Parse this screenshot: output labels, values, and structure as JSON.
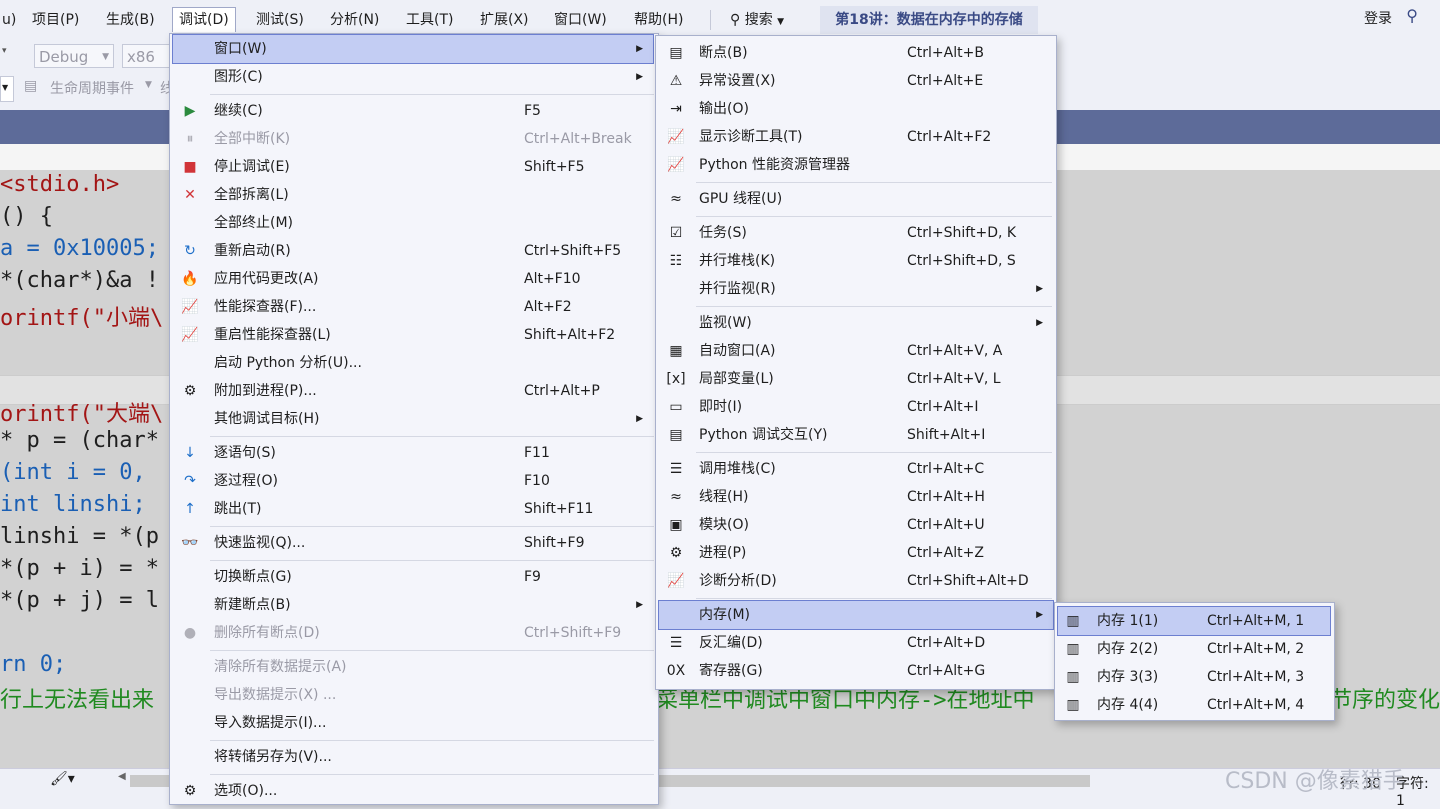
{
  "menubar": {
    "partial_first": "u)",
    "items": [
      "项目(P)",
      "生成(B)",
      "调试(D)",
      "测试(S)",
      "分析(N)",
      "工具(T)",
      "扩展(X)",
      "窗口(W)",
      "帮助(H)"
    ],
    "search_label": "搜索",
    "project_title": "第18讲：数据在内存中的存储",
    "login": "登录"
  },
  "toolbar": {
    "config": "Debug",
    "platform": "x86",
    "lifecycle": "生命周期事件",
    "partial": "线"
  },
  "code": {
    "lines": [
      {
        "text": "<stdio.h>",
        "cls": "str"
      },
      {
        "text": "() {",
        "cls": ""
      },
      {
        "text": "a = 0x10005;",
        "cls": "kw"
      },
      {
        "text": "*(char*)&a !",
        "cls": ""
      },
      {
        "text": "orintf(\"小端\\",
        "cls": "str"
      },
      {
        "text": "",
        "cls": ""
      },
      {
        "text": "",
        "cls": ""
      },
      {
        "text": "orintf(\"大端\\",
        "cls": "str"
      },
      {
        "text": "* p = (char*",
        "cls": ""
      },
      {
        "text": "(int i = 0,",
        "cls": "kw"
      },
      {
        "text": "int linshi;",
        "cls": "kw"
      },
      {
        "text": "linshi = *(p",
        "cls": ""
      },
      {
        "text": "*(p + i) = *",
        "cls": ""
      },
      {
        "text": "*(p + j) = l",
        "cls": ""
      },
      {
        "text": "",
        "cls": ""
      },
      {
        "text": "rn 0;",
        "cls": "kw"
      }
    ],
    "comment_left": "行上无法看出来",
    "comment_mid": "菜单栏中调试中窗口中内存->在地址中",
    "comment_right": "节序的变化"
  },
  "status": {
    "pos": "行: 30",
    "encoding": "字符: 1",
    "watermark": "CSDN @像素猎手"
  },
  "debug_menu": {
    "items": [
      {
        "label": "窗口(W)",
        "shortcut": "",
        "icon": "",
        "submenu": true,
        "selected": true
      },
      {
        "label": "图形(C)",
        "shortcut": "",
        "icon": "",
        "submenu": true
      },
      {
        "sep": true
      },
      {
        "label": "继续(C)",
        "shortcut": "F5",
        "icon": "▶",
        "icon_color": "#2b8a3e"
      },
      {
        "label": "全部中断(K)",
        "shortcut": "Ctrl+Alt+Break",
        "icon": "⏸",
        "disabled": true
      },
      {
        "label": "停止调试(E)",
        "shortcut": "Shift+F5",
        "icon": "■",
        "icon_color": "#d13438"
      },
      {
        "label": "全部拆离(L)",
        "shortcut": "",
        "icon": "✕",
        "icon_color": "#d13438"
      },
      {
        "label": "全部终止(M)",
        "shortcut": "",
        "icon": ""
      },
      {
        "label": "重新启动(R)",
        "shortcut": "Ctrl+Shift+F5",
        "icon": "↻",
        "icon_color": "#1e6fc9"
      },
      {
        "label": "应用代码更改(A)",
        "shortcut": "Alt+F10",
        "icon": "🔥",
        "icon_color": "#d13438"
      },
      {
        "label": "性能探查器(F)...",
        "shortcut": "Alt+F2",
        "icon": "📈"
      },
      {
        "label": "重启性能探查器(L)",
        "shortcut": "Shift+Alt+F2",
        "icon": "📈"
      },
      {
        "label": "启动 Python 分析(U)...",
        "shortcut": "",
        "icon": ""
      },
      {
        "label": "附加到进程(P)...",
        "shortcut": "Ctrl+Alt+P",
        "icon": "⚙"
      },
      {
        "label": "其他调试目标(H)",
        "shortcut": "",
        "icon": "",
        "submenu": true
      },
      {
        "sep": true
      },
      {
        "label": "逐语句(S)",
        "shortcut": "F11",
        "icon": "↓",
        "icon_color": "#1e6fc9"
      },
      {
        "label": "逐过程(O)",
        "shortcut": "F10",
        "icon": "↷",
        "icon_color": "#1e6fc9"
      },
      {
        "label": "跳出(T)",
        "shortcut": "Shift+F11",
        "icon": "↑",
        "icon_color": "#1e6fc9"
      },
      {
        "sep": true
      },
      {
        "label": "快速监视(Q)...",
        "shortcut": "Shift+F9",
        "icon": "👓"
      },
      {
        "sep": true
      },
      {
        "label": "切换断点(G)",
        "shortcut": "F9",
        "icon": ""
      },
      {
        "label": "新建断点(B)",
        "shortcut": "",
        "icon": "",
        "submenu": true
      },
      {
        "label": "删除所有断点(D)",
        "shortcut": "Ctrl+Shift+F9",
        "icon": "●",
        "disabled": true
      },
      {
        "sep": true
      },
      {
        "label": "清除所有数据提示(A)",
        "shortcut": "",
        "icon": "",
        "disabled": true
      },
      {
        "label": "导出数据提示(X) ...",
        "shortcut": "",
        "icon": "",
        "disabled": true
      },
      {
        "label": "导入数据提示(I)...",
        "shortcut": "",
        "icon": ""
      },
      {
        "sep": true
      },
      {
        "label": "将转储另存为(V)...",
        "shortcut": "",
        "icon": ""
      },
      {
        "sep": true
      },
      {
        "label": "选项(O)...",
        "shortcut": "",
        "icon": "⚙"
      }
    ]
  },
  "window_menu": {
    "items": [
      {
        "label": "断点(B)",
        "shortcut": "Ctrl+Alt+B",
        "icon": "▤"
      },
      {
        "label": "异常设置(X)",
        "shortcut": "Ctrl+Alt+E",
        "icon": "⚠"
      },
      {
        "label": "输出(O)",
        "shortcut": "",
        "icon": "⇥"
      },
      {
        "label": "显示诊断工具(T)",
        "shortcut": "Ctrl+Alt+F2",
        "icon": "📈"
      },
      {
        "label": "Python 性能资源管理器",
        "shortcut": "",
        "icon": "📈"
      },
      {
        "sep": true
      },
      {
        "label": "GPU 线程(U)",
        "shortcut": "",
        "icon": "≈"
      },
      {
        "sep": true
      },
      {
        "label": "任务(S)",
        "shortcut": "Ctrl+Shift+D, K",
        "icon": "☑"
      },
      {
        "label": "并行堆栈(K)",
        "shortcut": "Ctrl+Shift+D, S",
        "icon": "☷"
      },
      {
        "label": "并行监视(R)",
        "shortcut": "",
        "icon": "",
        "submenu": true
      },
      {
        "sep": true
      },
      {
        "label": "监视(W)",
        "shortcut": "",
        "icon": "",
        "submenu": true
      },
      {
        "label": "自动窗口(A)",
        "shortcut": "Ctrl+Alt+V, A",
        "icon": "▦"
      },
      {
        "label": "局部变量(L)",
        "shortcut": "Ctrl+Alt+V, L",
        "icon": "[x]"
      },
      {
        "label": "即时(I)",
        "shortcut": "Ctrl+Alt+I",
        "icon": "▭"
      },
      {
        "label": "Python 调试交互(Y)",
        "shortcut": "Shift+Alt+I",
        "icon": "▤"
      },
      {
        "sep": true
      },
      {
        "label": "调用堆栈(C)",
        "shortcut": "Ctrl+Alt+C",
        "icon": "☰"
      },
      {
        "label": "线程(H)",
        "shortcut": "Ctrl+Alt+H",
        "icon": "≈"
      },
      {
        "label": "模块(O)",
        "shortcut": "Ctrl+Alt+U",
        "icon": "▣"
      },
      {
        "label": "进程(P)",
        "shortcut": "Ctrl+Alt+Z",
        "icon": "⚙"
      },
      {
        "label": "诊断分析(D)",
        "shortcut": "Ctrl+Shift+Alt+D",
        "icon": "📈"
      },
      {
        "sep": true
      },
      {
        "label": "内存(M)",
        "shortcut": "",
        "icon": "",
        "submenu": true,
        "selected": true
      },
      {
        "label": "反汇编(D)",
        "shortcut": "Ctrl+Alt+D",
        "icon": "☰"
      },
      {
        "label": "寄存器(G)",
        "shortcut": "Ctrl+Alt+G",
        "icon": "0X"
      }
    ]
  },
  "memory_menu": {
    "items": [
      {
        "label": "内存 1(1)",
        "shortcut": "Ctrl+Alt+M, 1",
        "icon": "▥",
        "selected": true
      },
      {
        "label": "内存 2(2)",
        "shortcut": "Ctrl+Alt+M, 2",
        "icon": "▥"
      },
      {
        "label": "内存 3(3)",
        "shortcut": "Ctrl+Alt+M, 3",
        "icon": "▥"
      },
      {
        "label": "内存 4(4)",
        "shortcut": "Ctrl+Alt+M, 4",
        "icon": "▥"
      }
    ]
  }
}
